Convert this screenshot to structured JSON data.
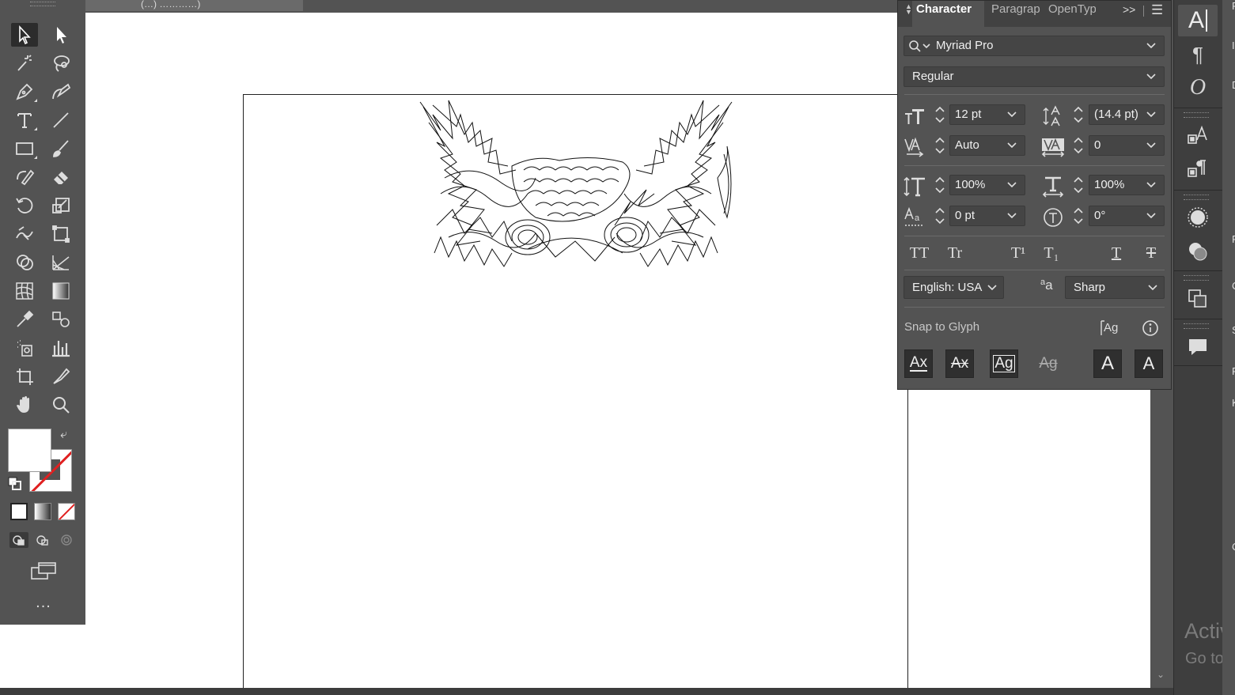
{
  "document": {
    "tab_title": "(…) …………)"
  },
  "panel": {
    "tabs": [
      "Character",
      "Paragraph",
      "OpenType"
    ],
    "tab_display": [
      "Character",
      "Paragrap",
      "OpenTyp"
    ],
    "overflow_label": ">>",
    "font_family": "Myriad Pro",
    "font_style": "Regular",
    "font_size": "12 pt",
    "leading": "(14.4 pt)",
    "kerning": "Auto",
    "tracking": "0",
    "vertical_scale": "100%",
    "horizontal_scale": "100%",
    "baseline_shift": "0 pt",
    "rotation": "0°",
    "language": "English: USA",
    "antialiasing": "Sharp",
    "aa_label": "a",
    "snap_label": "Snap to Glyph",
    "style_buttons": [
      "TT",
      "Tr",
      "T¹",
      "T₁",
      "T",
      "T"
    ],
    "snap_buttons": [
      "Ax",
      "Ax",
      "Ag",
      "Ag",
      "A",
      "A"
    ]
  },
  "dock": {
    "glyph_A": "A",
    "glyph_para": "¶",
    "glyph_o": "O"
  },
  "watermark": {
    "line1": "Activ",
    "line2": "Go to S"
  },
  "sliver_letters": [
    "F",
    "I",
    "D",
    "F",
    "C",
    "S",
    "F",
    "K",
    "C"
  ],
  "colors": {
    "panel_bg": "#535353",
    "tab_bg": "#424242",
    "field_bg": "#454545",
    "canvas": "#ffffff",
    "stroke_none": "#e02020"
  }
}
